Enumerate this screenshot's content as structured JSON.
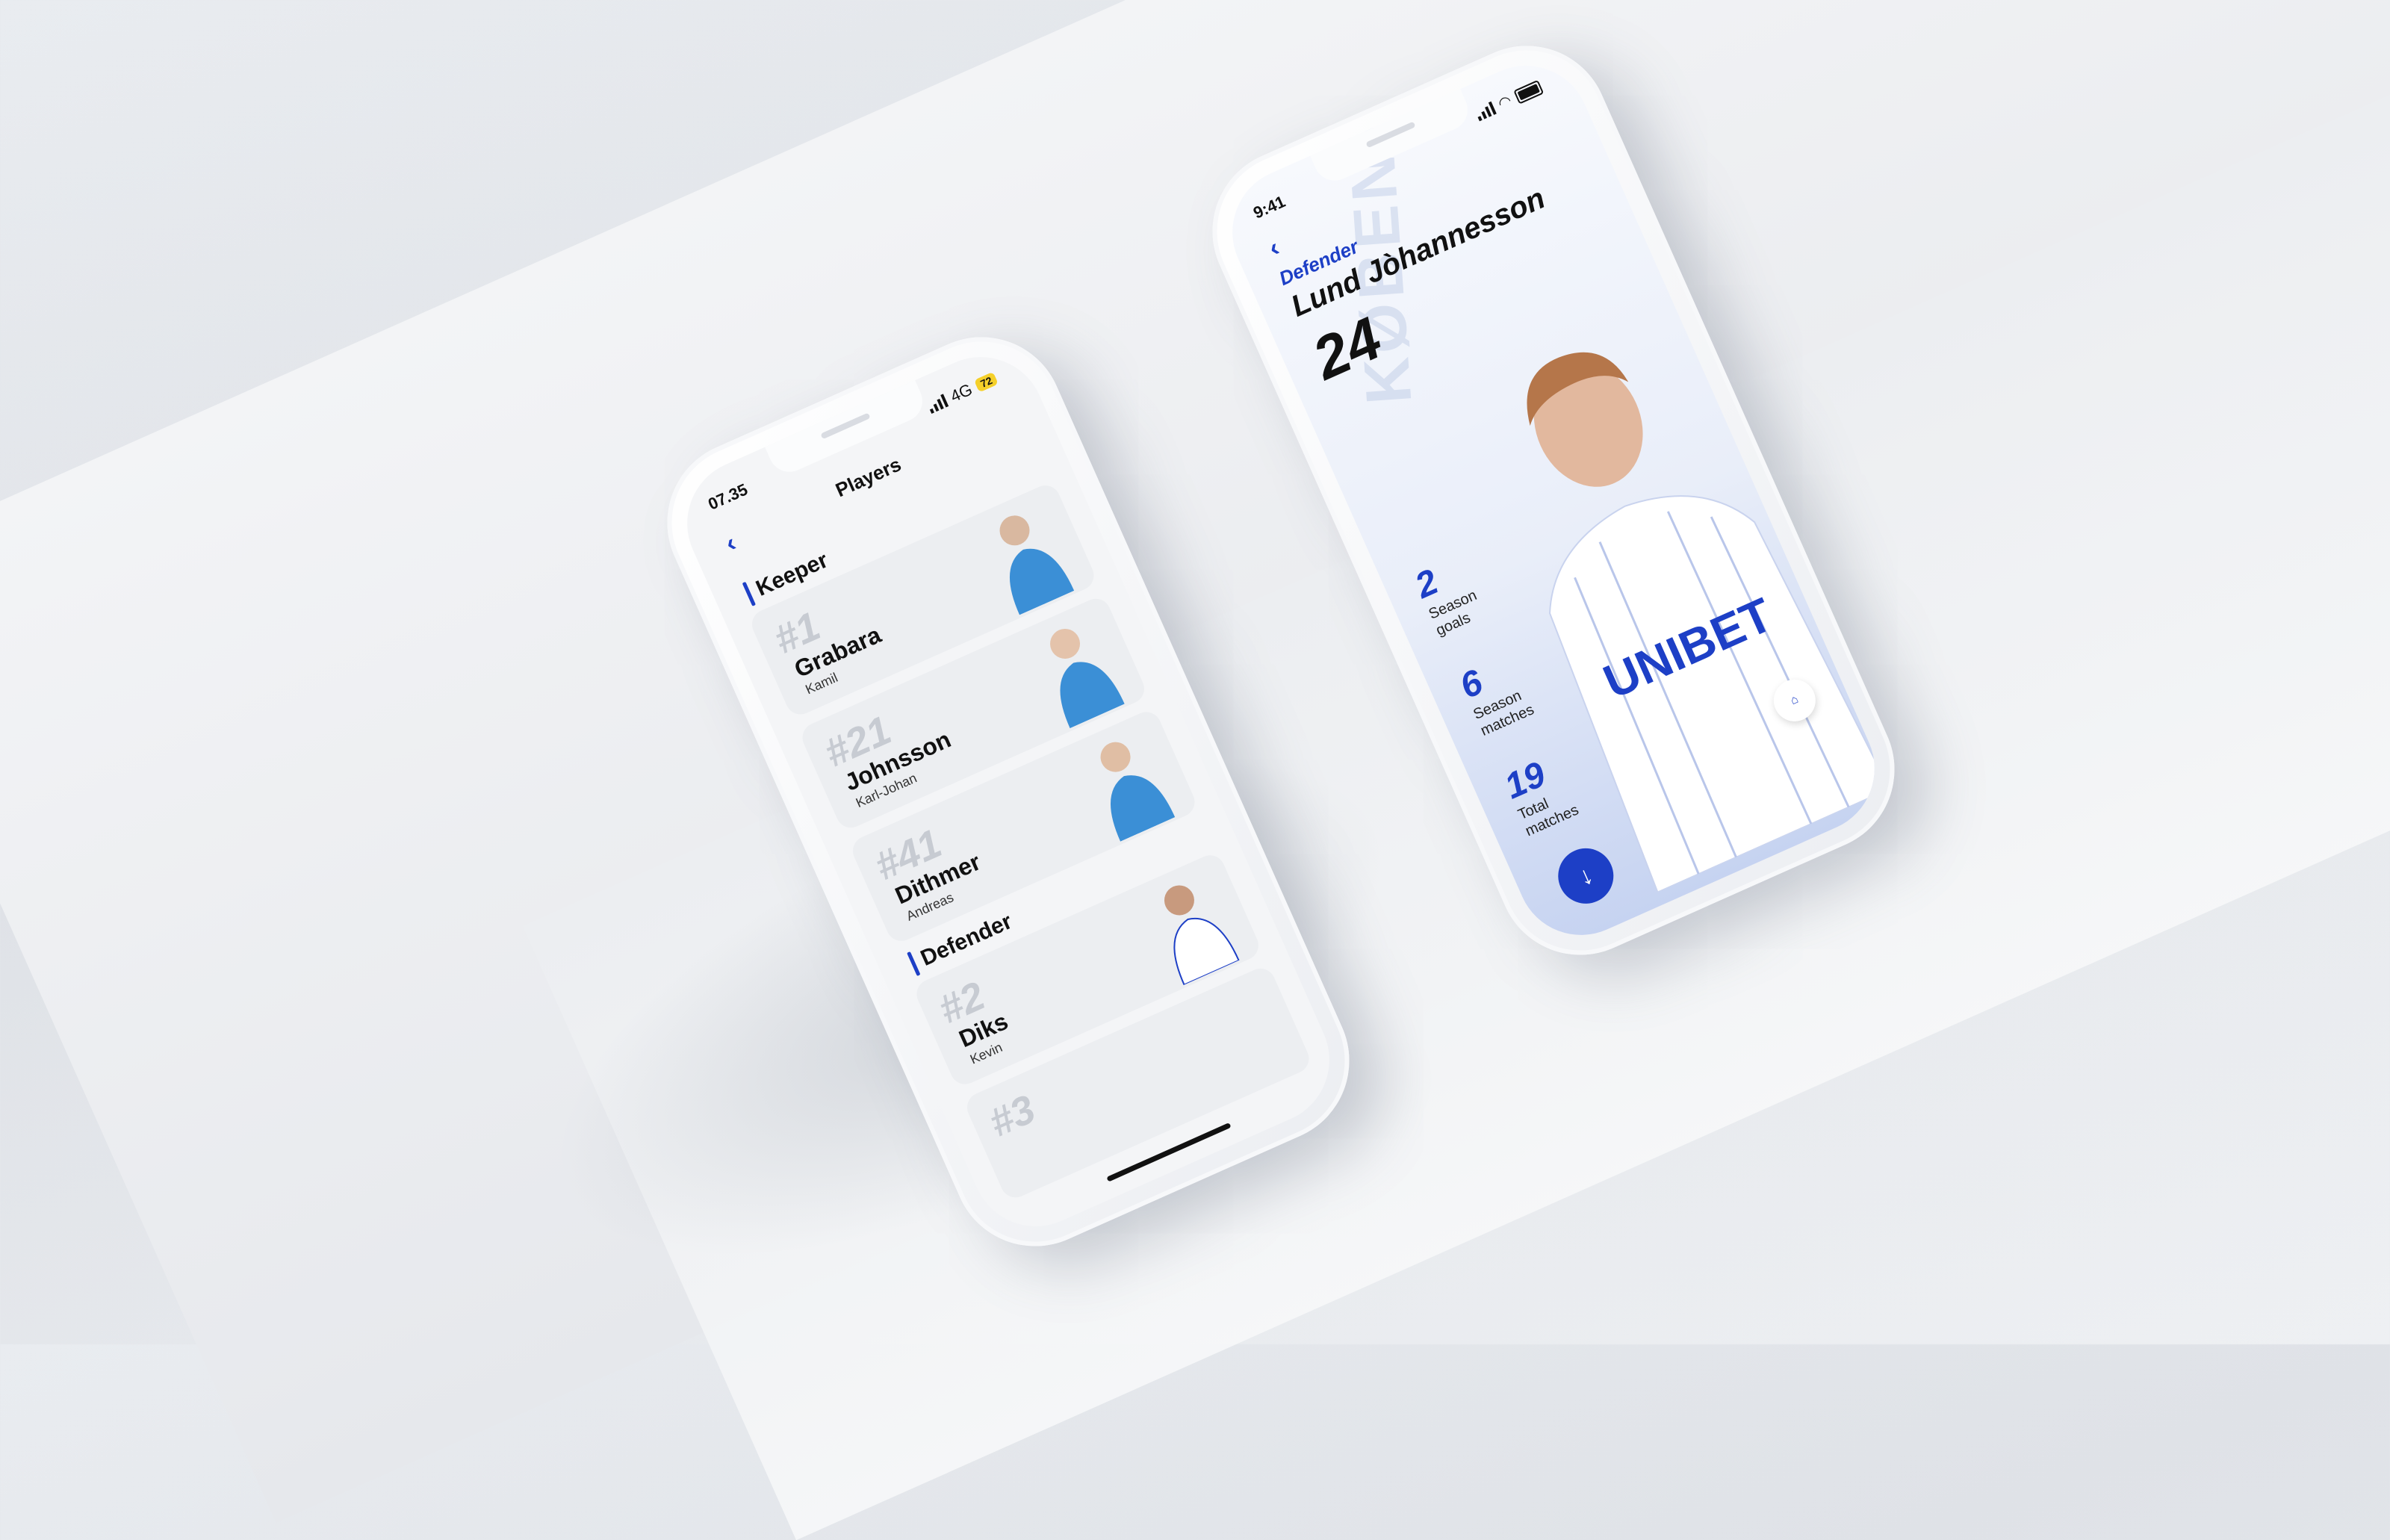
{
  "left_phone": {
    "status": {
      "time": "07.35",
      "network": "4G",
      "battery": "72"
    },
    "nav": {
      "title": "Players",
      "back_icon": "chevron-left-icon"
    },
    "sections": [
      {
        "label": "Keeper",
        "players": [
          {
            "number": "#1",
            "last": "Grabara",
            "first": "Kamil",
            "kit": "blue"
          },
          {
            "number": "#21",
            "last": "Johnsson",
            "first": "Karl-Johan",
            "kit": "blue"
          },
          {
            "number": "#41",
            "last": "Dithmer",
            "first": "Andreas",
            "kit": "blue"
          }
        ]
      },
      {
        "label": "Defender",
        "players": [
          {
            "number": "#2",
            "last": "Diks",
            "first": "Kevin",
            "kit": "white"
          },
          {
            "number": "#3",
            "last": "",
            "first": "",
            "kit": "white"
          }
        ]
      }
    ]
  },
  "right_phone": {
    "status": {
      "time": "9:41"
    },
    "back_icon": "chevron-left-icon",
    "position": "Defender",
    "name": "Lund Jòhannesson",
    "number": "24",
    "watermark": "KØBENHAVN",
    "stats": [
      {
        "value": "2",
        "label1": "Season",
        "label2": "goals"
      },
      {
        "value": "6",
        "label1": "Season",
        "label2": "matches"
      },
      {
        "value": "19",
        "label1": "Total",
        "label2": "matches"
      }
    ],
    "sponsor": "UNIBET",
    "fab_icon": "arrow-down-icon",
    "shirt_icon": "shirt-icon"
  },
  "colors": {
    "accent": "#1d3fc6",
    "keeper_kit": "#3b8fd6",
    "home_kit": "#ffffff"
  }
}
